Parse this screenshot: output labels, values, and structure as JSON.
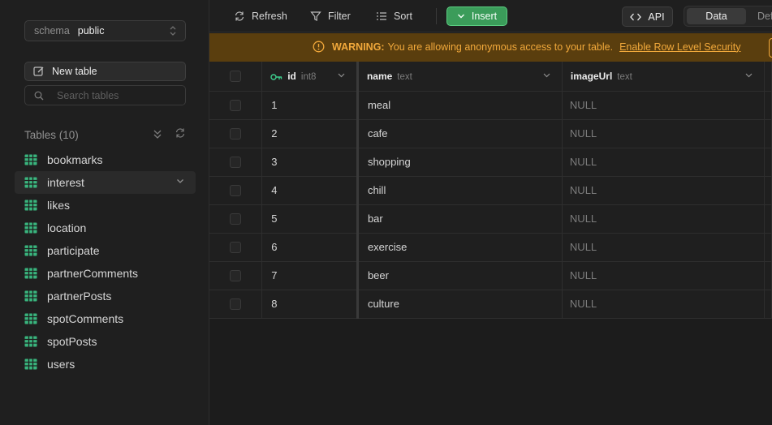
{
  "sidebar": {
    "schema_label": "schema",
    "schema_value": "public",
    "new_table": "New table",
    "search_placeholder": "Search tables",
    "tables_header": "Tables (10)",
    "items": [
      {
        "label": "bookmarks"
      },
      {
        "label": "interest"
      },
      {
        "label": "likes"
      },
      {
        "label": "location"
      },
      {
        "label": "participate"
      },
      {
        "label": "partnerComments"
      },
      {
        "label": "partnerPosts"
      },
      {
        "label": "spotComments"
      },
      {
        "label": "spotPosts"
      },
      {
        "label": "users"
      }
    ],
    "active_item": "interest"
  },
  "toolbar": {
    "refresh": "Refresh",
    "filter": "Filter",
    "sort": "Sort",
    "insert": "Insert",
    "api": "API",
    "view_data": "Data",
    "view_def": "Def"
  },
  "warning": {
    "label": "WARNING:",
    "message": "You are allowing anonymous access to your table.",
    "link": "Enable Row Level Security"
  },
  "grid": {
    "columns": [
      {
        "name": "id",
        "type": "int8"
      },
      {
        "name": "name",
        "type": "text"
      },
      {
        "name": "imageUrl",
        "type": "text"
      }
    ],
    "rows": [
      {
        "id": "1",
        "name": "meal",
        "imageUrl": "NULL"
      },
      {
        "id": "2",
        "name": "cafe",
        "imageUrl": "NULL"
      },
      {
        "id": "3",
        "name": "shopping",
        "imageUrl": "NULL"
      },
      {
        "id": "4",
        "name": "chill",
        "imageUrl": "NULL"
      },
      {
        "id": "5",
        "name": "bar",
        "imageUrl": "NULL"
      },
      {
        "id": "6",
        "name": "exercise",
        "imageUrl": "NULL"
      },
      {
        "id": "7",
        "name": "beer",
        "imageUrl": "NULL"
      },
      {
        "id": "8",
        "name": "culture",
        "imageUrl": "NULL"
      }
    ]
  },
  "colors": {
    "accent_green": "#3b9c5a",
    "warning_bg": "#5a3e0e",
    "warning_text": "#f2a93b",
    "table_icon_green": "#3ecf8e"
  }
}
